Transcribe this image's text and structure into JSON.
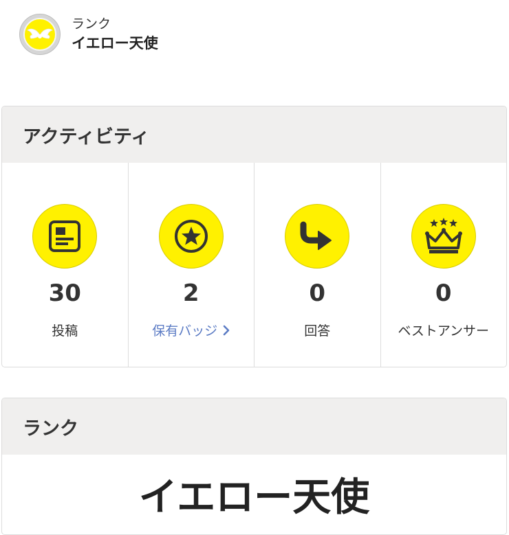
{
  "profile": {
    "rank_caption": "ランク",
    "rank_name": "イエロー天使",
    "badge_icon": "angel-wings-icon"
  },
  "activity": {
    "title": "アクティビティ",
    "stats": [
      {
        "value": "30",
        "label": "投稿",
        "icon": "post-icon"
      },
      {
        "value": "2",
        "label": "保有バッジ",
        "icon": "star-badge-icon"
      },
      {
        "value": "0",
        "label": "回答",
        "icon": "reply-arrow-icon"
      },
      {
        "value": "0",
        "label": "ベストアンサー",
        "icon": "crown-icon"
      }
    ]
  },
  "rank_section": {
    "title": "ランク",
    "rank_name": "イエロー天使"
  },
  "colors": {
    "accent_yellow": "#fff100",
    "link_blue": "#5b7bc4",
    "header_bg": "#f0efee",
    "icon_dark": "#333333"
  }
}
